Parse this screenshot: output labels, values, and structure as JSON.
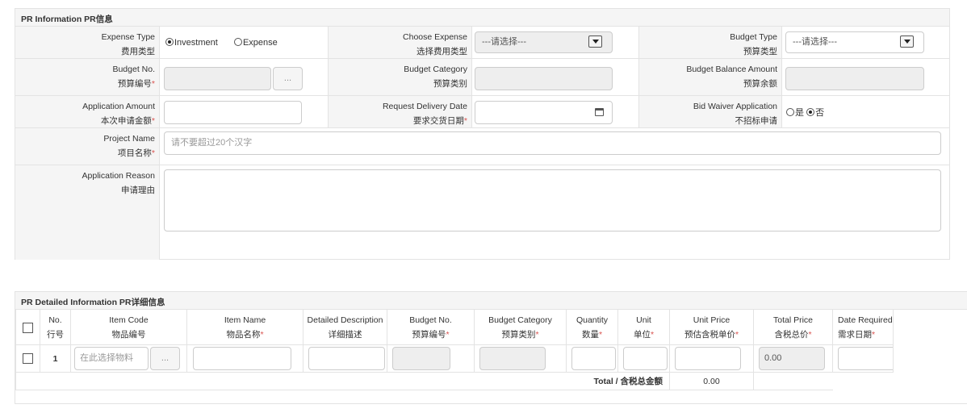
{
  "pr_info": {
    "title": "PR Information PR信息",
    "expense_type": {
      "en": "Expense Type",
      "zh": "费用类型",
      "options": [
        "Investment",
        "Expense"
      ],
      "selected": "Investment"
    },
    "choose_expense": {
      "en": "Choose Expense",
      "zh": "选择费用类型",
      "value": "---请选择---"
    },
    "budget_type": {
      "en": "Budget Type",
      "zh": "预算类型",
      "value": "---请选择---"
    },
    "budget_no": {
      "en": "Budget No.",
      "zh": "预算编号",
      "button": "..."
    },
    "budget_category": {
      "en": "Budget Category",
      "zh": "预算类别"
    },
    "budget_balance": {
      "en": "Budget Balance Amount",
      "zh": "预算余额"
    },
    "application_amount": {
      "en": "Application Amount",
      "zh": "本次申请金额"
    },
    "request_delivery_date": {
      "en": "Request Delivery Date",
      "zh": "要求交货日期"
    },
    "bid_waiver": {
      "en": "Bid Waiver Application",
      "zh": "不招标申请",
      "options": [
        "是",
        "否"
      ],
      "selected": "否"
    },
    "project_name": {
      "en": "Project Name",
      "zh": "项目名称",
      "placeholder": "请不要超过20个汉字"
    },
    "application_reason": {
      "en": "Application Reason",
      "zh": "申请理由"
    },
    "required_mark": "*"
  },
  "pr_detail": {
    "title": "PR Detailed Information PR详细信息",
    "columns": [
      {
        "en": "No.",
        "zh": "行号",
        "required": false
      },
      {
        "en": "Item Code",
        "zh": "物品编号",
        "required": false
      },
      {
        "en": "Item Name",
        "zh": "物品名称",
        "required": true
      },
      {
        "en": "Detailed Description",
        "zh": "详细描述",
        "required": false
      },
      {
        "en": "Budget No.",
        "zh": "预算编号",
        "required": true
      },
      {
        "en": "Budget Category",
        "zh": "预算类别",
        "required": true
      },
      {
        "en": "Quantity",
        "zh": "数量",
        "required": true
      },
      {
        "en": "Unit",
        "zh": "单位",
        "required": true
      },
      {
        "en": "Unit Price",
        "zh": "预估含税单价",
        "required": true
      },
      {
        "en": "Total Price",
        "zh": "含税总价",
        "required": true
      },
      {
        "en": "Date Required",
        "zh": "需求日期",
        "required": true
      }
    ],
    "rows": [
      {
        "no": "1",
        "item_code_placeholder": "在此选择物料",
        "button": "...",
        "total_price": "0.00"
      }
    ],
    "total_label": "Total / 含税总金额",
    "total_value": "0.00"
  }
}
